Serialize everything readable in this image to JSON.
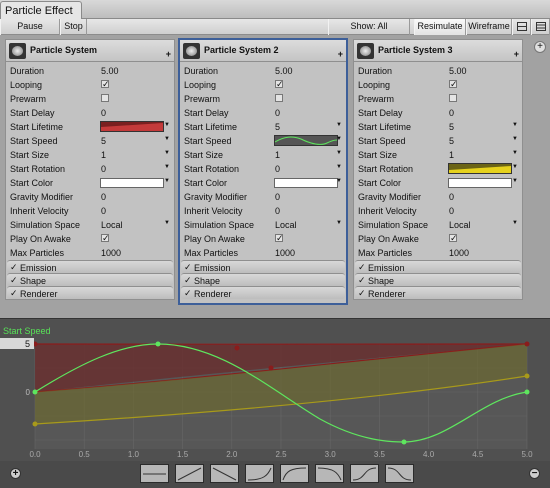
{
  "window": {
    "title": "Particle Effect"
  },
  "toolbar": {
    "pause": "Pause",
    "stop": "Stop",
    "show": "Show: All",
    "resimulate": "Resimulate",
    "wireframe": "Wireframe"
  },
  "labels": {
    "duration": "Duration",
    "looping": "Looping",
    "prewarm": "Prewarm",
    "start_delay": "Start Delay",
    "start_lifetime": "Start Lifetime",
    "start_speed": "Start Speed",
    "start_size": "Start Size",
    "start_rotation": "Start Rotation",
    "start_color": "Start Color",
    "gravity_modifier": "Gravity Modifier",
    "inherit_velocity": "Inherit Velocity",
    "simulation_space": "Simulation Space",
    "play_on_awake": "Play On Awake",
    "max_particles": "Max Particles"
  },
  "modules": {
    "emission": "Emission",
    "shape": "Shape",
    "renderer": "Renderer"
  },
  "systems": [
    {
      "name": "Particle System",
      "duration": "5.00",
      "looping": true,
      "prewarm": false,
      "start_delay": "0",
      "start_lifetime": "",
      "start_speed": "5",
      "start_size": "1",
      "start_rotation": "0",
      "gravity_modifier": "0",
      "inherit_velocity": "0",
      "simulation_space": "Local",
      "play_on_awake": true,
      "max_particles": "1000",
      "emission_on": true,
      "shape_on": true,
      "renderer_on": true
    },
    {
      "name": "Particle System 2",
      "duration": "5.00",
      "looping": true,
      "prewarm": false,
      "start_delay": "0",
      "start_lifetime": "5",
      "start_speed": "",
      "start_size": "1",
      "start_rotation": "0",
      "gravity_modifier": "0",
      "inherit_velocity": "0",
      "simulation_space": "Local",
      "play_on_awake": true,
      "max_particles": "1000",
      "emission_on": true,
      "shape_on": true,
      "renderer_on": true
    },
    {
      "name": "Particle System 3",
      "duration": "5.00",
      "looping": true,
      "prewarm": false,
      "start_delay": "0",
      "start_lifetime": "5",
      "start_speed": "5",
      "start_size": "1",
      "start_rotation": "",
      "gravity_modifier": "0",
      "inherit_velocity": "0",
      "simulation_space": "Local",
      "play_on_awake": true,
      "max_particles": "1000",
      "emission_on": true,
      "shape_on": true,
      "renderer_on": true
    }
  ],
  "curve_editor": {
    "title": "Start Speed",
    "y_top_label": "5",
    "y_zero_label": "0",
    "x_ticks": [
      "0.0",
      "0.5",
      "1.0",
      "1.5",
      "2.0",
      "2.5",
      "3.0",
      "3.5",
      "4.0",
      "4.5",
      "5.0"
    ],
    "colors": {
      "green": "#5ee65e",
      "red": "#8a1c1c",
      "yellow": "#a89a1a"
    }
  },
  "bottom": {
    "add": "+",
    "remove": "−"
  }
}
